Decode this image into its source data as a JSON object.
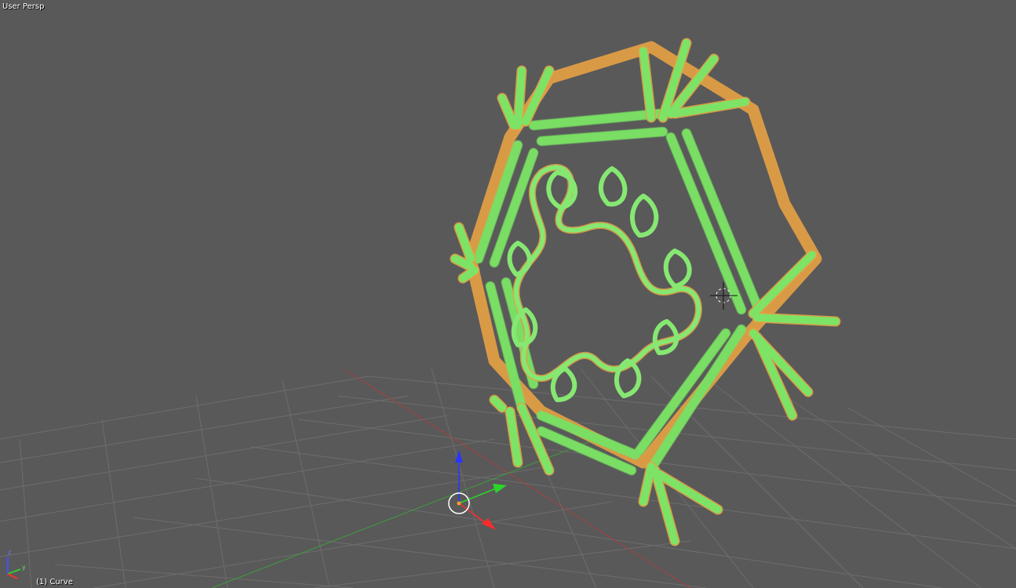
{
  "viewport": {
    "view_name": "User Persp",
    "object_info": "(1) Curve"
  },
  "nav_gizmo": {
    "z_label": "z",
    "y_label": "y"
  },
  "colors": {
    "background": "#595959",
    "grid_line": "#6b6b6b",
    "x_axis": "#a84040",
    "y_axis": "#3f9a3f",
    "object_fill": "#7fe36a",
    "object_outline": "#f0a040",
    "manipulator_z": "#2a36ff",
    "manipulator_y": "#2ad52a",
    "manipulator_x": "#ff2a2a"
  },
  "object": {
    "name": "Curve",
    "selected": true
  }
}
